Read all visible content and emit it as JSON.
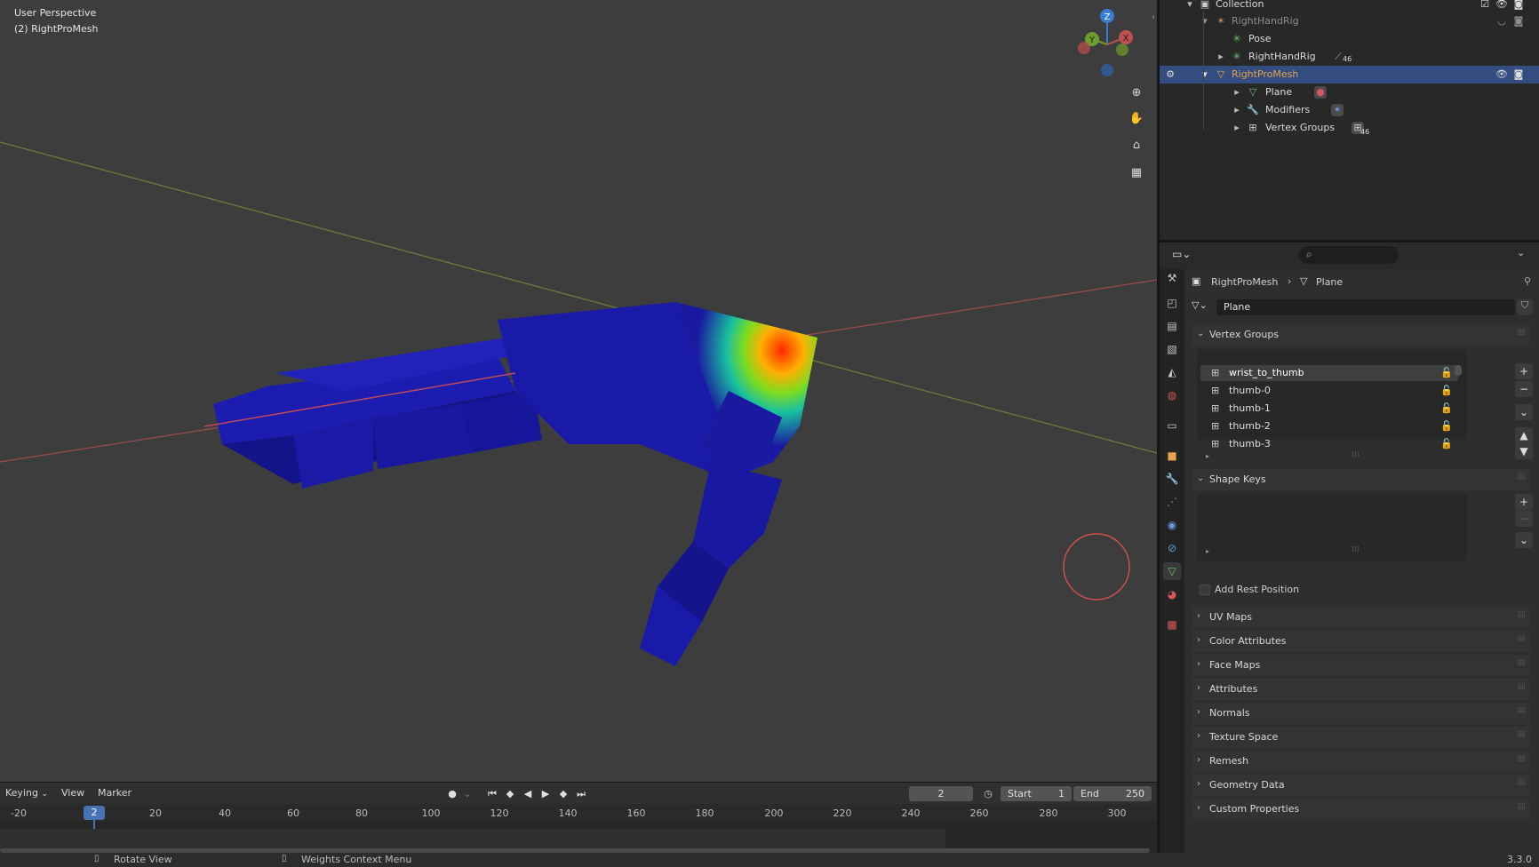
{
  "viewport": {
    "mode_label": "User Perspective",
    "object_label": "(2) RightProMesh",
    "gizmo": {
      "z": "Z",
      "y": "Y",
      "x": "X"
    }
  },
  "timeline": {
    "menus": [
      "Keying",
      "View",
      "Marker"
    ],
    "current_frame": "2",
    "start_label": "Start",
    "start_value": "1",
    "end_label": "End",
    "end_value": "250",
    "ruler_ticks": [
      "-20",
      "2",
      "20",
      "40",
      "60",
      "80",
      "100",
      "120",
      "140",
      "160",
      "180",
      "200",
      "220",
      "240",
      "260",
      "280",
      "300"
    ]
  },
  "statusbar": {
    "left_hint": "Rotate View",
    "middle_hint": "Weights Context Menu",
    "version": "3.3.0"
  },
  "outliner": {
    "rows": [
      {
        "label": "Collection",
        "icon": "collection-icon"
      },
      {
        "label": "RightHandRig",
        "icon": "armature-icon"
      },
      {
        "label": "Pose",
        "icon": "pose-icon"
      },
      {
        "label": "RightHandRig",
        "icon": "armature-data-icon",
        "badge": "46"
      },
      {
        "label": "RightProMesh",
        "icon": "mesh-object-icon",
        "selected": true
      },
      {
        "label": "Plane",
        "icon": "mesh-data-icon"
      },
      {
        "label": "Modifiers",
        "icon": "wrench-icon"
      },
      {
        "label": "Vertex Groups",
        "icon": "vertex-groups-icon",
        "badge": "46"
      }
    ]
  },
  "properties": {
    "search_placeholder": "",
    "breadcrumb": {
      "object": "RightProMesh",
      "data": "Plane"
    },
    "datablock_name": "Plane",
    "vertex_groups": {
      "title": "Vertex Groups",
      "items": [
        "wrist_to_thumb",
        "thumb-0",
        "thumb-1",
        "thumb-2",
        "thumb-3"
      ]
    },
    "shape_keys": {
      "title": "Shape Keys",
      "add_rest_position": "Add Rest Position"
    },
    "collapsed_panels": [
      "UV Maps",
      "Color Attributes",
      "Face Maps",
      "Attributes",
      "Normals",
      "Texture Space",
      "Remesh",
      "Geometry Data",
      "Custom Properties"
    ]
  },
  "colors": {
    "selected_row": "#334d80",
    "accent_orange": "#e8a24d",
    "x_axis": "#c0504d",
    "y_axis": "#6b8e23",
    "z_axis": "#3a7bd5",
    "mesh_blue": "#1a1aa0"
  }
}
